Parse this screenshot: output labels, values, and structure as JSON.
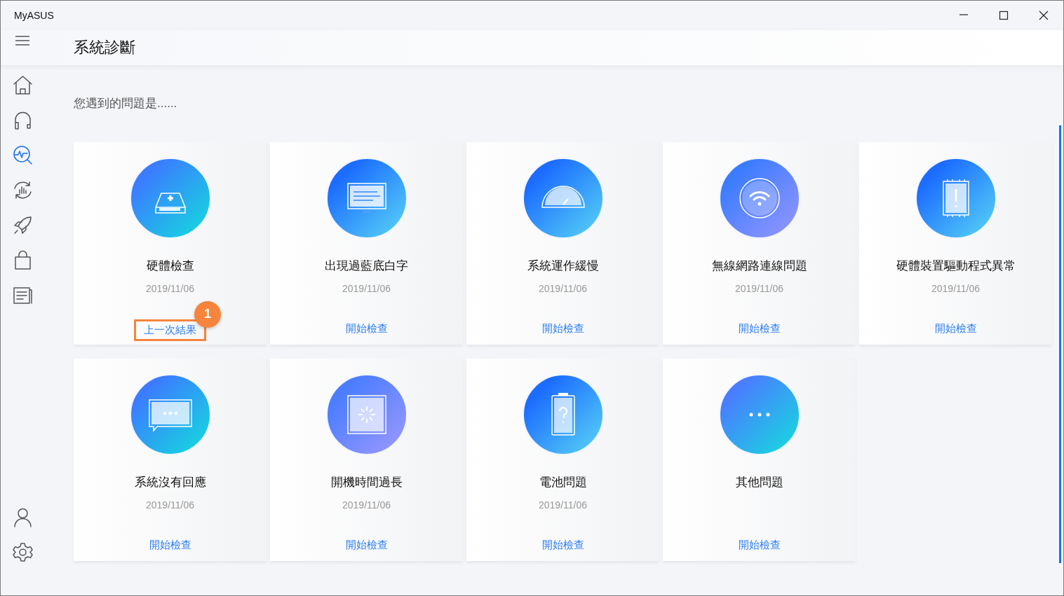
{
  "window": {
    "title": "MyASUS"
  },
  "sidebar": {
    "items": [
      {
        "kind": "home",
        "selected": false
      },
      {
        "kind": "headset",
        "selected": false
      },
      {
        "kind": "diagnosis",
        "selected": true
      },
      {
        "kind": "update",
        "selected": false
      },
      {
        "kind": "rocket",
        "selected": false
      },
      {
        "kind": "bag",
        "selected": false
      },
      {
        "kind": "news",
        "selected": false
      }
    ],
    "bottom_items": [
      {
        "kind": "user",
        "selected": false
      },
      {
        "kind": "settings",
        "selected": false
      }
    ]
  },
  "page_title": "系統診斷",
  "prompt": "您遇到的問題是......",
  "cards": [
    {
      "kind": "drive",
      "title": "硬體檢查",
      "date": "2019/11/06",
      "action": "上一次結果",
      "callout": "1"
    },
    {
      "kind": "monitor",
      "title": "出現過藍底白字",
      "date": "2019/11/06",
      "action": "開始檢查"
    },
    {
      "kind": "gauge",
      "title": "系統運作緩慢",
      "date": "2019/11/06",
      "action": "開始檢查"
    },
    {
      "kind": "wifi",
      "title": "無線網路連線問題",
      "date": "2019/11/06",
      "action": "開始檢查"
    },
    {
      "kind": "chip",
      "title": "硬體裝置驅動程式異常",
      "date": "2019/11/06",
      "action": "開始檢查"
    },
    {
      "kind": "chat",
      "title": "系統沒有回應",
      "date": "2019/11/06",
      "action": "開始檢查"
    },
    {
      "kind": "loading",
      "title": "開機時間過長",
      "date": "2019/11/06",
      "action": "開始檢查"
    },
    {
      "kind": "battery",
      "title": "電池問題",
      "date": "2019/11/06",
      "action": "開始檢查"
    },
    {
      "kind": "dots",
      "title": "其他問題",
      "action": "開始檢查"
    }
  ]
}
